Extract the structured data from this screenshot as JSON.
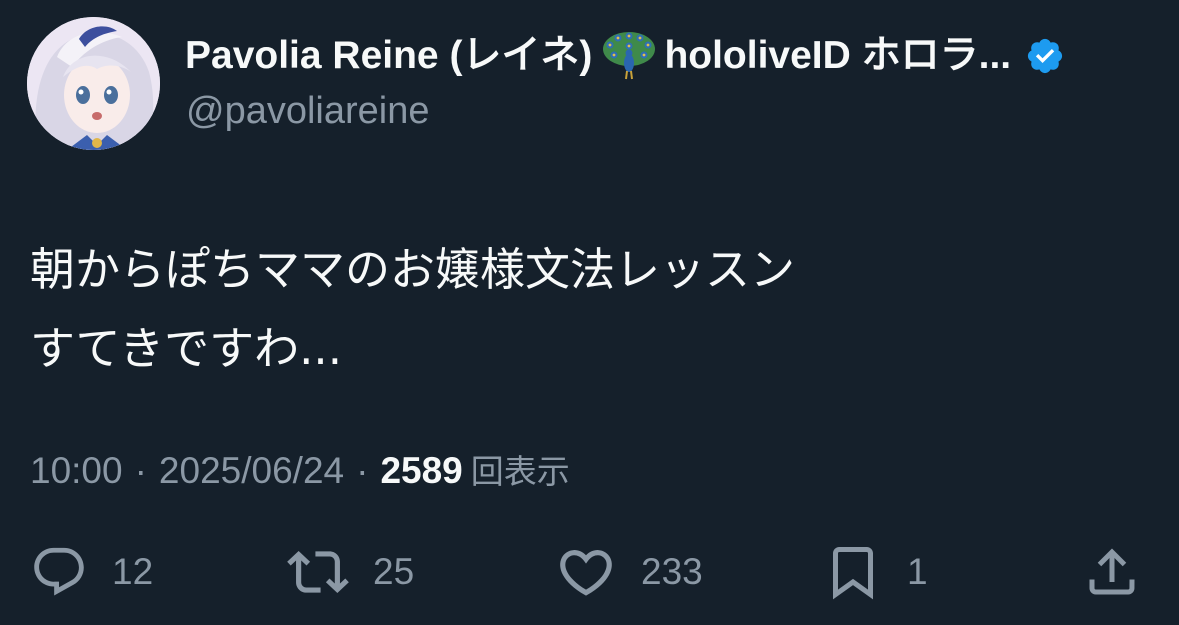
{
  "author": {
    "display_name_prefix": "Pavolia Reine (レイネ)",
    "display_name_suffix": "hololiveID ホロラ...",
    "emoji_icon": "peacock-icon",
    "verified_icon": "verified-badge-icon",
    "handle": "@pavoliareine"
  },
  "tweet": {
    "line1": "朝からぽちママのお嬢様文法レッスン",
    "line2": "すてきですわ..."
  },
  "meta": {
    "time": "10:00",
    "separator": "·",
    "date": "2025/06/24",
    "views_count": "2589",
    "views_label": "回表示"
  },
  "actions": {
    "reply": {
      "icon": "reply-icon",
      "count": "12"
    },
    "retweet": {
      "icon": "retweet-icon",
      "count": "25"
    },
    "like": {
      "icon": "heart-icon",
      "count": "233"
    },
    "bookmark": {
      "icon": "bookmark-icon",
      "count": "1"
    },
    "share": {
      "icon": "share-icon"
    }
  },
  "colors": {
    "background": "#15202b",
    "text_primary": "#f7f9f9",
    "text_secondary": "#8b98a5",
    "verified_blue": "#1d9bf0"
  }
}
